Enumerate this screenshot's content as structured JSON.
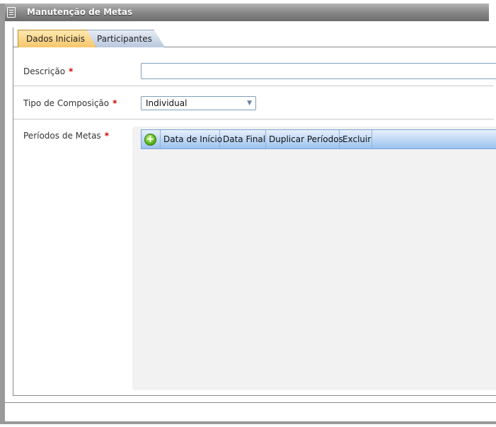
{
  "window": {
    "title": "Manutenção de Metas"
  },
  "tabs": [
    {
      "label": "Dados Iniciais",
      "active": true
    },
    {
      "label": "Participantes",
      "active": false
    }
  ],
  "form": {
    "descricao": {
      "label": "Descrição",
      "required_mark": "*",
      "value": ""
    },
    "tipo_composicao": {
      "label": "Tipo de Composição",
      "required_mark": "*",
      "selected": "Individual"
    },
    "periodos": {
      "label": "Períodos de Metas",
      "required_mark": "*"
    }
  },
  "grid": {
    "columns": [
      "Data de Início",
      "Data Final",
      "Duplicar Períodos",
      "Excluir"
    ],
    "rows": []
  },
  "colors": {
    "active_tab": "#f6c66a",
    "inactive_tab": "#b8c8de",
    "grid_header": "#9cc2ee",
    "required": "#d40000",
    "add_button": "#5bb51a"
  }
}
